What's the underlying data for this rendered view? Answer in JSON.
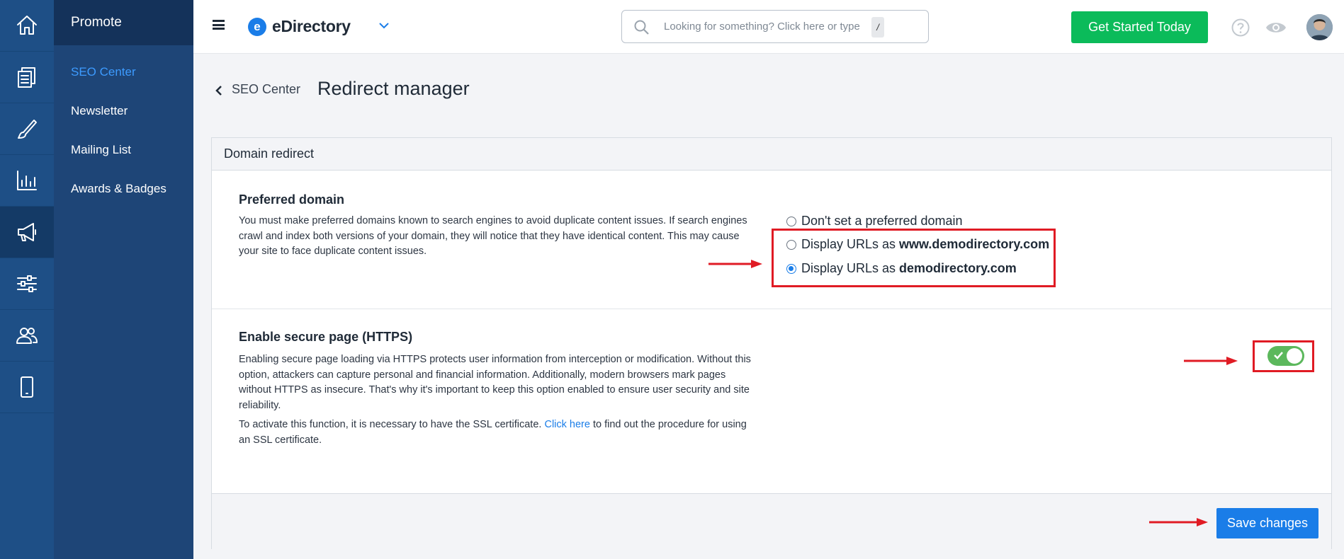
{
  "rail": {
    "items": [
      {
        "icon": "home-icon",
        "active": false
      },
      {
        "icon": "content-icon",
        "active": false
      },
      {
        "icon": "design-icon",
        "active": false
      },
      {
        "icon": "reports-icon",
        "active": false
      },
      {
        "icon": "promote-icon",
        "active": true
      },
      {
        "icon": "settings-icon",
        "active": false
      },
      {
        "icon": "users-icon",
        "active": false
      },
      {
        "icon": "mobile-icon",
        "active": false
      }
    ]
  },
  "subnav": {
    "heading": "Promote",
    "items": [
      "SEO Center",
      "Newsletter",
      "Mailing List",
      "Awards & Badges"
    ],
    "active_index": 0
  },
  "topbar": {
    "logo_text": "eDirectory",
    "logo_letter": "e",
    "search_placeholder": "Looking for something? Click here or type",
    "search_shortcut": "/",
    "cta_label": "Get Started Today"
  },
  "page": {
    "breadcrumb": "SEO Center",
    "title": "Redirect manager"
  },
  "panel": {
    "heading": "Domain redirect",
    "preferred": {
      "title": "Preferred domain",
      "description": "You must make preferred domains known to search engines to avoid duplicate content issues. If search engines crawl and index both versions of your domain, they will notice that they have identical content. This may cause your site to face duplicate content issues.",
      "options": [
        {
          "label": "Don't set a preferred domain",
          "bold": ""
        },
        {
          "label": "Display URLs as",
          "bold": "www.demodirectory.com"
        },
        {
          "label": "Display URLs as",
          "bold": "demodirectory.com"
        }
      ],
      "selected_index": 2
    },
    "https": {
      "title": "Enable secure page (HTTPS)",
      "description": "Enabling secure page loading via HTTPS protects user information from interception or modification. Without this option, attackers can capture personal and financial information. Additionally, modern browsers mark pages without HTTPS as insecure. That's why it's important to keep this option enabled to ensure user security and site reliability.",
      "ssl_prefix": "To activate this function, it is necessary to have the SSL certificate.",
      "ssl_link": "Click here",
      "ssl_suffix": "to find out the procedure for using an SSL certificate.",
      "enabled": true
    },
    "save_label": "Save changes"
  },
  "colors": {
    "rail": "#1e4f86",
    "subnav": "#1e4577",
    "accent": "#1a7de8",
    "cta": "#0bbb5a",
    "toggle_on": "#5cb85c",
    "annotation": "#e01b24"
  }
}
